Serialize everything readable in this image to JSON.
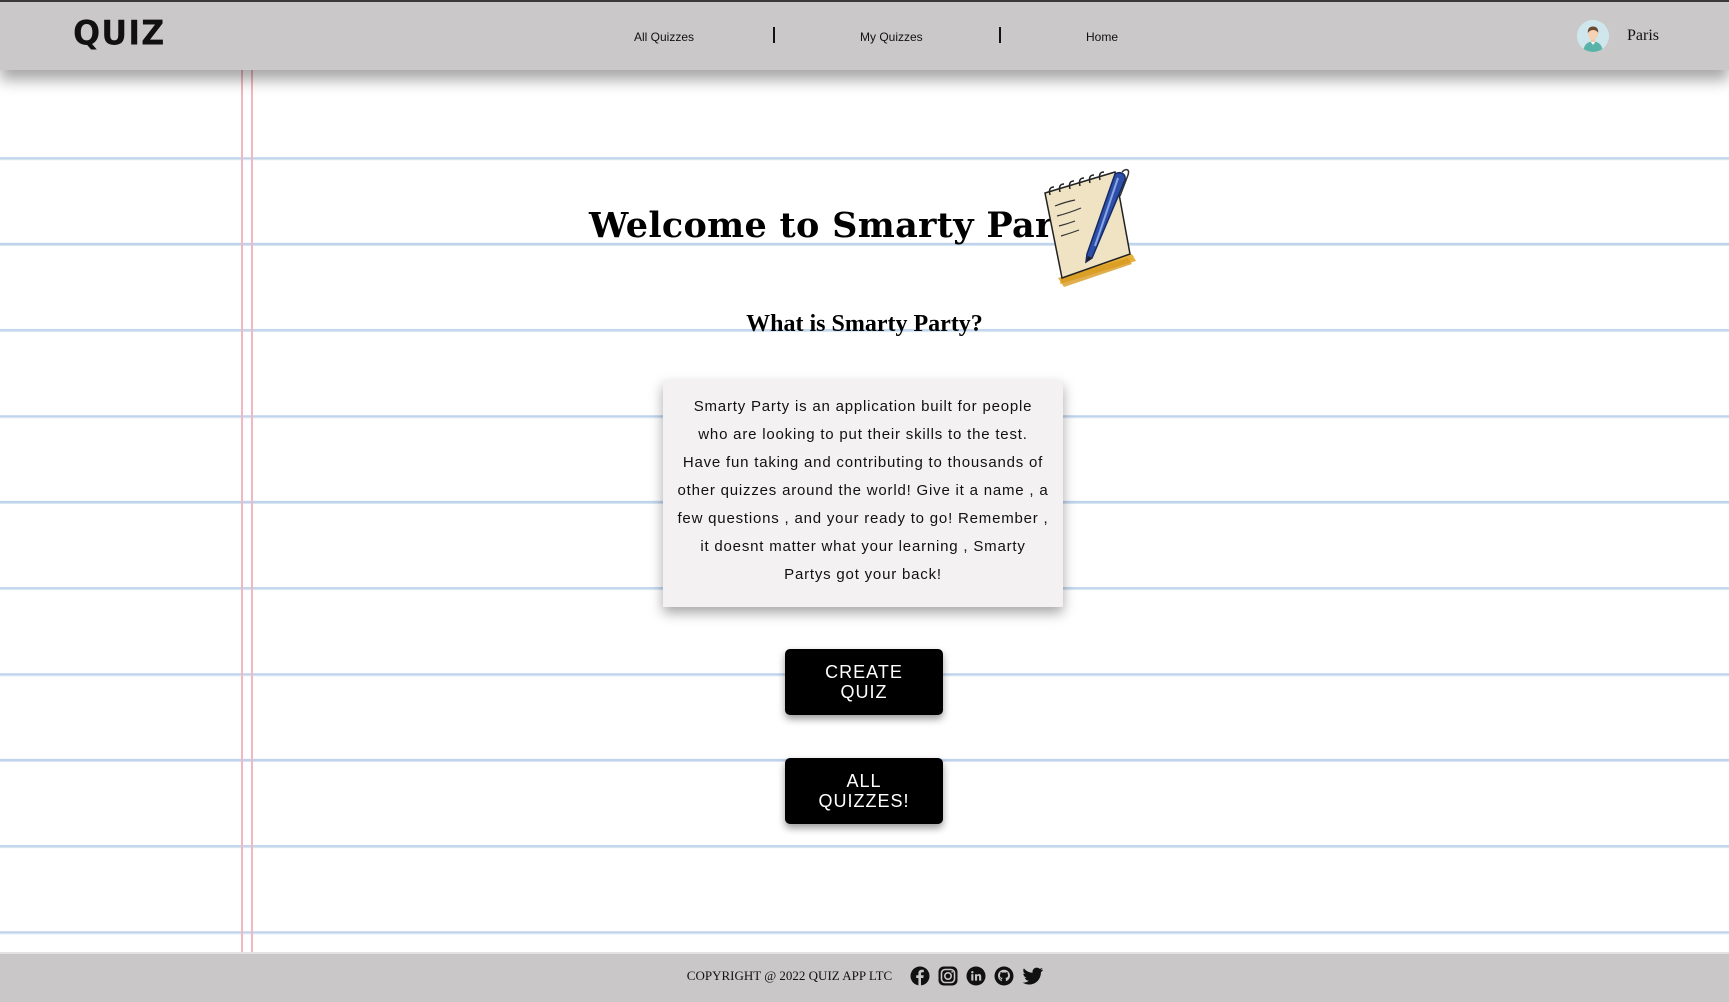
{
  "header": {
    "logo": "QUIZ",
    "nav": [
      {
        "label": "All Quizzes"
      },
      {
        "label": "My Quizzes"
      },
      {
        "label": "Home"
      }
    ],
    "user": {
      "name": "Paris",
      "avatar_icon": "user-avatar-icon"
    }
  },
  "main": {
    "title": "Welcome to Smarty Party",
    "subtitle": "What is Smarty Party?",
    "description": "Smarty Party is an application built for people who are looking to put their skills to the test. Have fun taking and contributing to thousands of other quizzes around the world! Give it a name , a few questions , and your ready to go! Remember , it doesnt matter what your learning , Smarty Partys got your back!",
    "buttons": {
      "create": "CREATE QUIZ",
      "all": "ALL QUIZZES!"
    },
    "illustration_icon": "notepad-pen-icon"
  },
  "footer": {
    "copyright": "COPYRIGHT @ 2022 QUIZ APP LTC",
    "social_icons": [
      "facebook-icon",
      "instagram-icon",
      "linkedin-icon",
      "github-icon",
      "twitter-icon"
    ]
  },
  "colors": {
    "header_bg": "#cac8c8",
    "paper_line": "#bfd4ec",
    "margin_line": "#f2b7c0",
    "button_bg": "#000000",
    "card_bg": "#f3f1f1"
  }
}
